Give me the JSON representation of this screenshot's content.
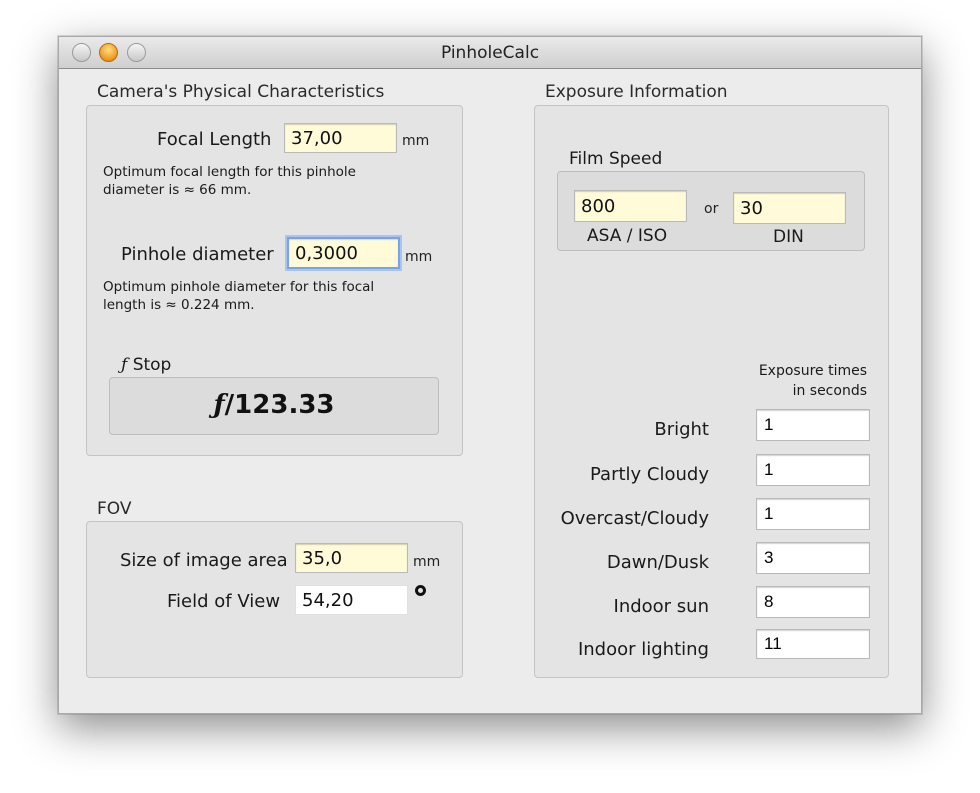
{
  "window": {
    "title": "PinholeCalc"
  },
  "camera": {
    "section_title": "Camera's Physical Characteristics",
    "focal_length_label": "Focal Length",
    "focal_length_value": "37,00",
    "focal_length_unit": "mm",
    "focal_note": "Optimum focal length for this pinhole diameter is ≈ 66 mm.",
    "pinhole_label": "Pinhole diameter",
    "pinhole_value": "0,3000",
    "pinhole_unit": "mm",
    "pinhole_note": "Optimum pinhole diameter for this focal length is ≈ 0.224 mm.",
    "fstop_label_f": "ƒ",
    "fstop_label": "Stop",
    "fstop_value_f": "ƒ",
    "fstop_value": "/123.33"
  },
  "fov": {
    "section_title": "FOV",
    "size_label": "Size of image area",
    "size_value": "35,0",
    "size_unit": "mm",
    "fov_label": "Field of View",
    "fov_value": "54,20",
    "degree_symbol_icon": "degree-icon"
  },
  "exposure": {
    "section_title": "Exposure Information",
    "film_speed_title": "Film Speed",
    "asa_value": "800",
    "asa_label": "ASA / ISO",
    "or_label": "or",
    "din_value": "30",
    "din_label": "DIN",
    "times_header_line1": "Exposure times",
    "times_header_line2": "in seconds",
    "rows": [
      {
        "label": "Bright",
        "value": "1"
      },
      {
        "label": "Partly Cloudy",
        "value": "1"
      },
      {
        "label": "Overcast/Cloudy",
        "value": "1"
      },
      {
        "label": "Dawn/Dusk",
        "value": "3"
      },
      {
        "label": "Indoor sun",
        "value": "8"
      },
      {
        "label": "Indoor lighting",
        "value": "11"
      }
    ]
  },
  "colors": {
    "input_highlight": "#fffbd8",
    "focus_ring": "#7aa3e4",
    "window_bg": "#ececec"
  }
}
